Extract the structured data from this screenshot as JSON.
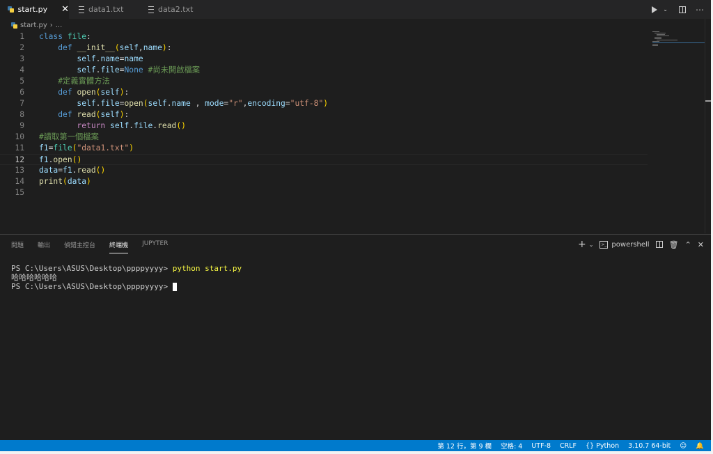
{
  "tabs": [
    {
      "label": "start.py",
      "icon": "python-file-icon"
    },
    {
      "label": "data1.txt",
      "icon": "text-file-icon"
    },
    {
      "label": "data2.txt",
      "icon": "text-file-icon"
    }
  ],
  "breadcrumb": {
    "file": "start.py",
    "more": "..."
  },
  "code": [
    {
      "n": "1"
    },
    {
      "n": "2"
    },
    {
      "n": "3"
    },
    {
      "n": "4"
    },
    {
      "n": "5"
    },
    {
      "n": "6"
    },
    {
      "n": "7"
    },
    {
      "n": "8"
    },
    {
      "n": "9"
    },
    {
      "n": "10"
    },
    {
      "n": "11"
    },
    {
      "n": "12"
    },
    {
      "n": "13"
    },
    {
      "n": "14"
    },
    {
      "n": "15"
    }
  ],
  "tokens": {
    "class": "class",
    "file": "file",
    "def": "def",
    "init": "__init__",
    "self": "self",
    "name": "name",
    "None": "None",
    "open": "open",
    "read": "read",
    "return": "return",
    "print": "print",
    "data": "data",
    "f1": "f1",
    "mode": "mode",
    "encoding": "encoding",
    "r": "\"r\"",
    "utf8": "\"utf-8\"",
    "data1txt": "\"data1.txt\"",
    "c4": "#尚未開啟檔案",
    "c5": "#定義實體方法",
    "c10": "#讀取第一個檔案"
  },
  "panel": {
    "tabs": [
      "問題",
      "輸出",
      "偵錯主控台",
      "終端機",
      "JUPYTER"
    ],
    "active_tab": "終端機",
    "terminal_name": "powershell"
  },
  "terminal": {
    "prompt": "PS C:\\Users\\ASUS\\Desktop\\ppppyyyy> ",
    "command": "python start.py",
    "output": "哈哈哈哈哈哈"
  },
  "status": {
    "position": "第 12 行，第 9 欄",
    "spaces": "空格: 4",
    "encoding": "UTF-8",
    "eol": "CRLF",
    "language": "Python",
    "interpreter": "3.10.7 64-bit"
  },
  "colors": {
    "statusbar": "#007acc",
    "editor_bg": "#1e1e1e",
    "keyword": "#569cd6"
  }
}
